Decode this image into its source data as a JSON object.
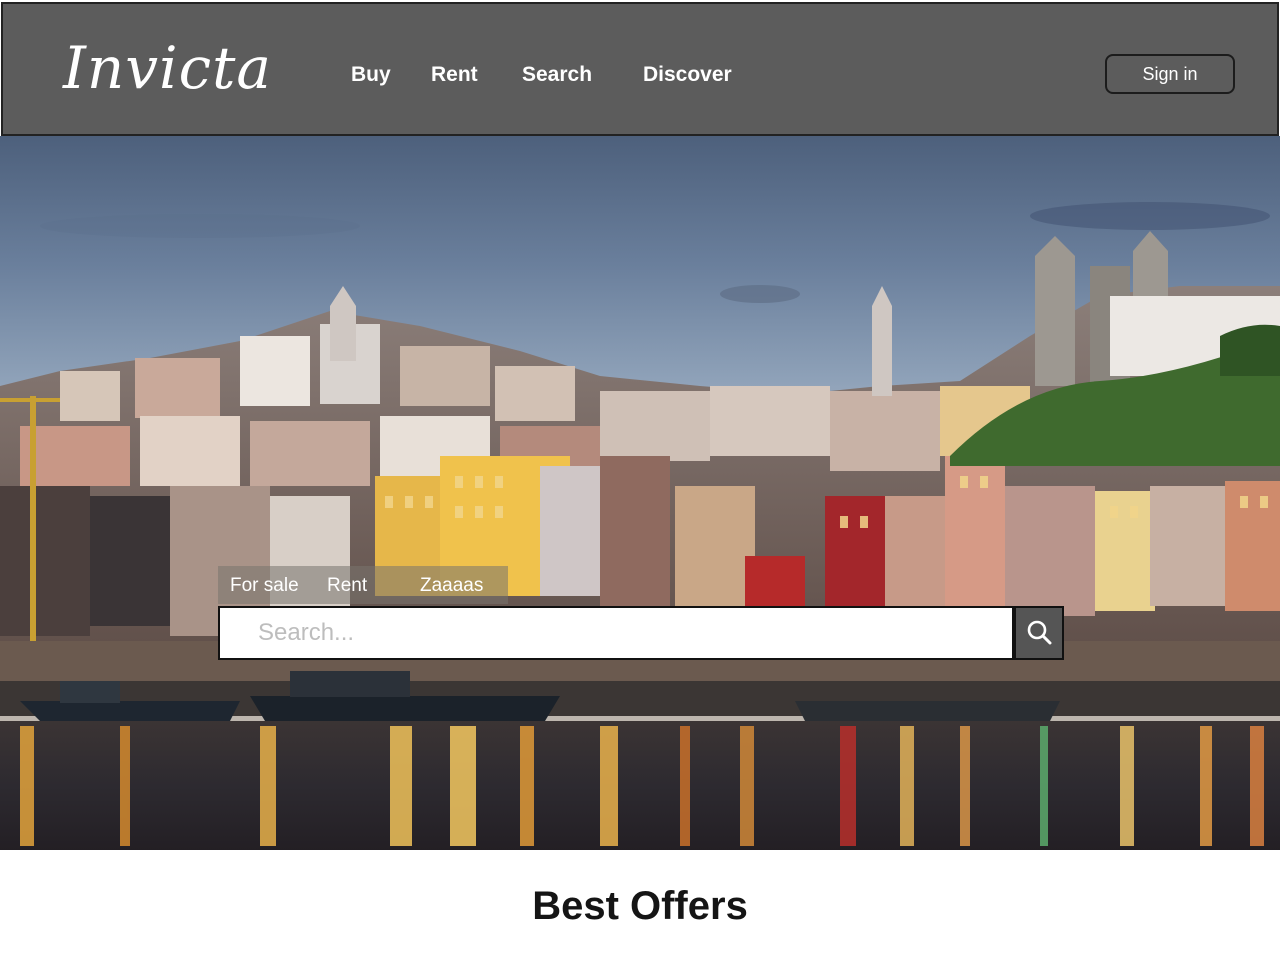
{
  "header": {
    "logo": "Invicta",
    "nav": [
      "Buy",
      "Rent",
      "Search",
      "Discover"
    ],
    "signin_label": "Sign in"
  },
  "hero": {
    "tabs": [
      "For sale",
      "Rent",
      "Zaaaas"
    ],
    "search": {
      "placeholder": "Search...",
      "value": ""
    },
    "search_icon": "magnifier-icon"
  },
  "sections": {
    "best_offers_title": "Best Offers"
  },
  "colors": {
    "header_bg": "#5c5c5c",
    "search_button": "#555555"
  }
}
